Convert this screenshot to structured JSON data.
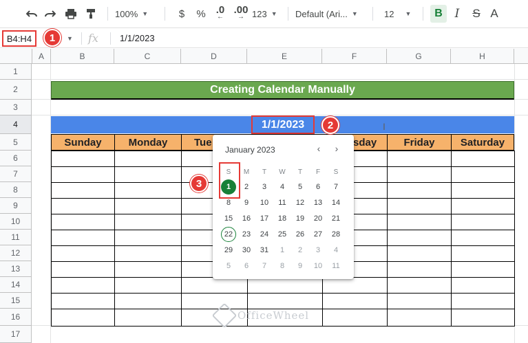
{
  "toolbar": {
    "undo_icon": "undo-icon",
    "redo_icon": "redo-icon",
    "print_icon": "print-icon",
    "paint_format_icon": "paint-format-icon",
    "zoom": "100%",
    "currency": "$",
    "percent": "%",
    "decrease_decimal": ".0",
    "increase_decimal": ".00",
    "more_formats": "123",
    "font": "Default (Ari...",
    "font_size": "12",
    "bold": "B",
    "italic": "I",
    "strikethrough": "S",
    "text_color": "A"
  },
  "formula_bar": {
    "name_box": "B4:H4",
    "fx": "fx",
    "value": "1/1/2023"
  },
  "callouts": [
    "1",
    "2",
    "3"
  ],
  "columns": [
    "A",
    "B",
    "C",
    "D",
    "E",
    "F",
    "G",
    "H"
  ],
  "rows": [
    "1",
    "2",
    "3",
    "4",
    "5",
    "6",
    "7",
    "8",
    "9",
    "10",
    "11",
    "12",
    "13",
    "14",
    "15",
    "16",
    "17"
  ],
  "sheet": {
    "title": "Creating Calendar Manually",
    "date": "1/1/2023",
    "day_headers": [
      "Sunday",
      "Monday",
      "Tue",
      "sday",
      "Friday",
      "Saturday"
    ]
  },
  "date_picker": {
    "month_label": "January 2023",
    "prev_icon": "chevron-left-icon",
    "next_icon": "chevron-right-icon",
    "weekdays": [
      "S",
      "M",
      "T",
      "W",
      "T",
      "F",
      "S"
    ],
    "weeks": [
      [
        "1",
        "2",
        "3",
        "4",
        "5",
        "6",
        "7"
      ],
      [
        "8",
        "9",
        "10",
        "11",
        "12",
        "13",
        "14"
      ],
      [
        "15",
        "16",
        "17",
        "18",
        "19",
        "20",
        "21"
      ],
      [
        "22",
        "23",
        "24",
        "25",
        "26",
        "27",
        "28"
      ],
      [
        "29",
        "30",
        "31",
        "1",
        "2",
        "3",
        "4"
      ],
      [
        "5",
        "6",
        "7",
        "8",
        "9",
        "10",
        "11"
      ]
    ],
    "selected": "1",
    "today": "22"
  },
  "watermark": "OfficeWheel",
  "colors": {
    "title_bg": "#6aa84f",
    "date_bar_bg": "#4a86e8",
    "day_header_bg": "#f6b26b",
    "callout": "#e53935",
    "selected_day": "#188038"
  }
}
